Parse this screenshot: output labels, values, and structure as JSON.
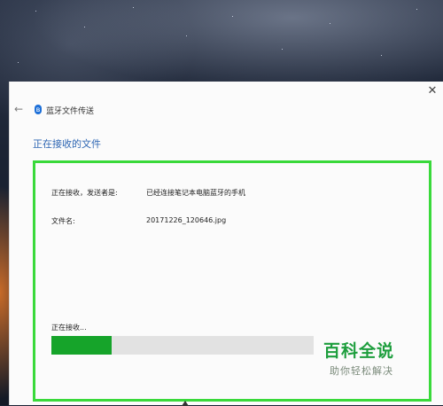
{
  "dialog": {
    "close_glyph": "✕",
    "back_glyph": "←",
    "title": "蓝牙文件传送",
    "heading": "正在接收的文件"
  },
  "transfer": {
    "sender_label": "正在接收，发送者是:",
    "sender_value": "已经连接笔记本电脑蓝牙的手机",
    "filename_label": "文件名:",
    "filename_value": "20171226_120646.jpg",
    "status_text": "正在接收...",
    "progress_fraction": 0.23
  },
  "watermark": {
    "title": "百科全说",
    "subtitle": "助你轻松解决"
  },
  "colors": {
    "accent": "#2e66b3",
    "highlight_border": "#39d93a",
    "progress": "#16a42a",
    "bluetooth": "#1c6fd8"
  },
  "icons": {
    "close": "close-icon",
    "back": "back-arrow-icon",
    "bluetooth": "bluetooth-icon"
  }
}
